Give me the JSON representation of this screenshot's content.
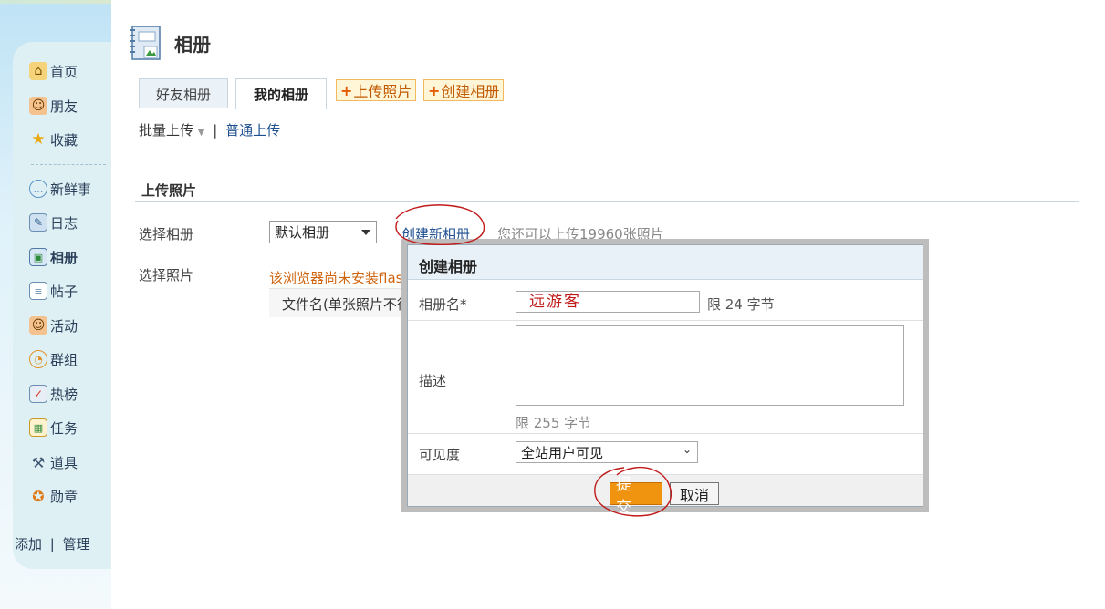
{
  "sidebar": {
    "items": [
      {
        "label": "首页",
        "icon": "home-icon"
      },
      {
        "label": "朋友",
        "icon": "friends-icon"
      },
      {
        "label": "收藏",
        "icon": "star-icon"
      },
      {
        "label": "新鲜事",
        "icon": "speech-bubble-icon"
      },
      {
        "label": "日志",
        "icon": "blog-icon"
      },
      {
        "label": "相册",
        "icon": "album-icon",
        "active": true
      },
      {
        "label": "帖子",
        "icon": "post-icon"
      },
      {
        "label": "活动",
        "icon": "event-icon"
      },
      {
        "label": "群组",
        "icon": "group-icon"
      },
      {
        "label": "热榜",
        "icon": "hot-list-icon"
      },
      {
        "label": "任务",
        "icon": "task-icon"
      },
      {
        "label": "道具",
        "icon": "hammer-icon"
      },
      {
        "label": "勋章",
        "icon": "medal-icon"
      }
    ],
    "add_label": "添加",
    "divider": "|",
    "manage_label": "管理"
  },
  "header": {
    "title": "相册"
  },
  "tabs": [
    {
      "label": "好友相册",
      "active": false
    },
    {
      "label": "我的相册",
      "active": true
    }
  ],
  "actions": {
    "upload_photo": "上传照片",
    "create_album": "创建相册",
    "plus": "+"
  },
  "upload_mode": {
    "batch": "批量上传",
    "divider": "|",
    "normal": "普通上传"
  },
  "upload_section": {
    "title": "上传照片",
    "select_album_label": "选择相册",
    "album_value": "默认相册",
    "create_new_album": "创建新相册",
    "remaining_text": "您还可以上传19960张照片",
    "select_photo_label": "选择照片",
    "flash_warning": "该浏览器尚未安装flash",
    "filename_header": "文件名(单张照片不得"
  },
  "dialog": {
    "title": "创建相册",
    "name_label": "相册名*",
    "name_value": "远游客",
    "name_limit": "限 24 字节",
    "desc_label": "描述",
    "desc_value": "",
    "desc_limit": "限 255 字节",
    "visibility_label": "可见度",
    "visibility_value": "全站用户可见",
    "submit_label": "提 交",
    "cancel_label": "取消"
  },
  "colors": {
    "accent": "#f0930e",
    "link": "#1d4e8f",
    "warning": "#d0650f",
    "annotation": "#c11a1a"
  }
}
